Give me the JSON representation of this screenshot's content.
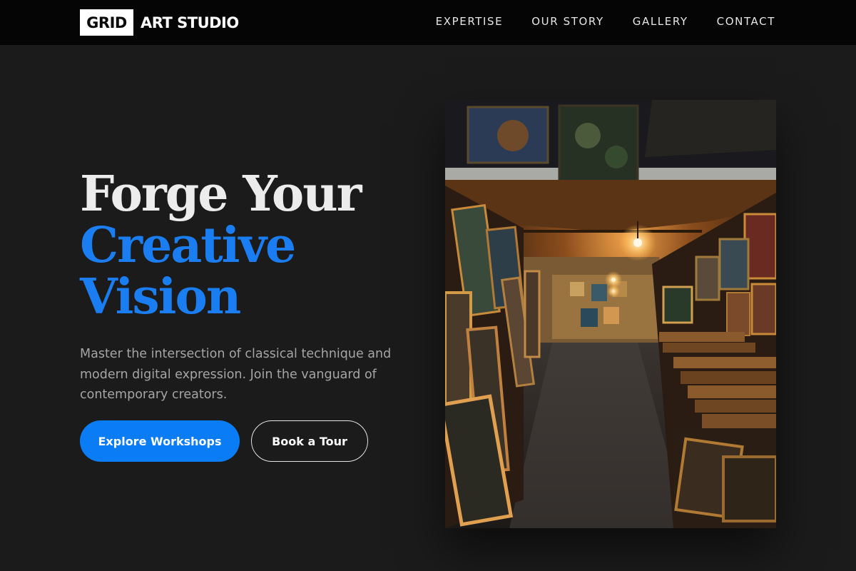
{
  "brand": {
    "logo_box": "GRID",
    "logo_text": "ART STUDIO"
  },
  "nav": {
    "items": [
      {
        "label": "EXPERTISE"
      },
      {
        "label": "OUR STORY"
      },
      {
        "label": "GALLERY"
      },
      {
        "label": "CONTACT"
      }
    ]
  },
  "hero": {
    "headline_line1": "Forge Your",
    "headline_line2": "Creative",
    "headline_line3": "Vision",
    "description": "Master the intersection of classical technique and modern digital expression. Join the vanguard of contemporary creators.",
    "primary_button": "Explore Workshops",
    "secondary_button": "Book a Tour"
  },
  "colors": {
    "background": "#1b1b1b",
    "nav_background": "#050505",
    "accent": "#0a7cf6",
    "text_muted": "#a5a5a5"
  },
  "image": {
    "subject": "art-studio-gallery-corridor-photo"
  }
}
